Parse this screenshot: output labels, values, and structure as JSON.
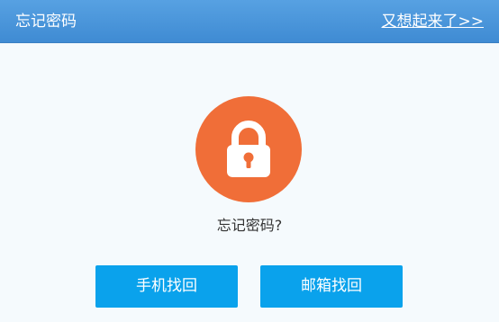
{
  "header": {
    "title": "忘记密码",
    "remember_link": "又想起来了>>"
  },
  "main": {
    "icon": "lock-icon",
    "question": "忘记密码?",
    "buttons": {
      "phone": "手机找回",
      "email": "邮箱找回"
    }
  },
  "colors": {
    "header": "#4a96da",
    "lock_circle": "#f06e38",
    "button": "#0aa2ec",
    "background": "#f5fafd"
  }
}
